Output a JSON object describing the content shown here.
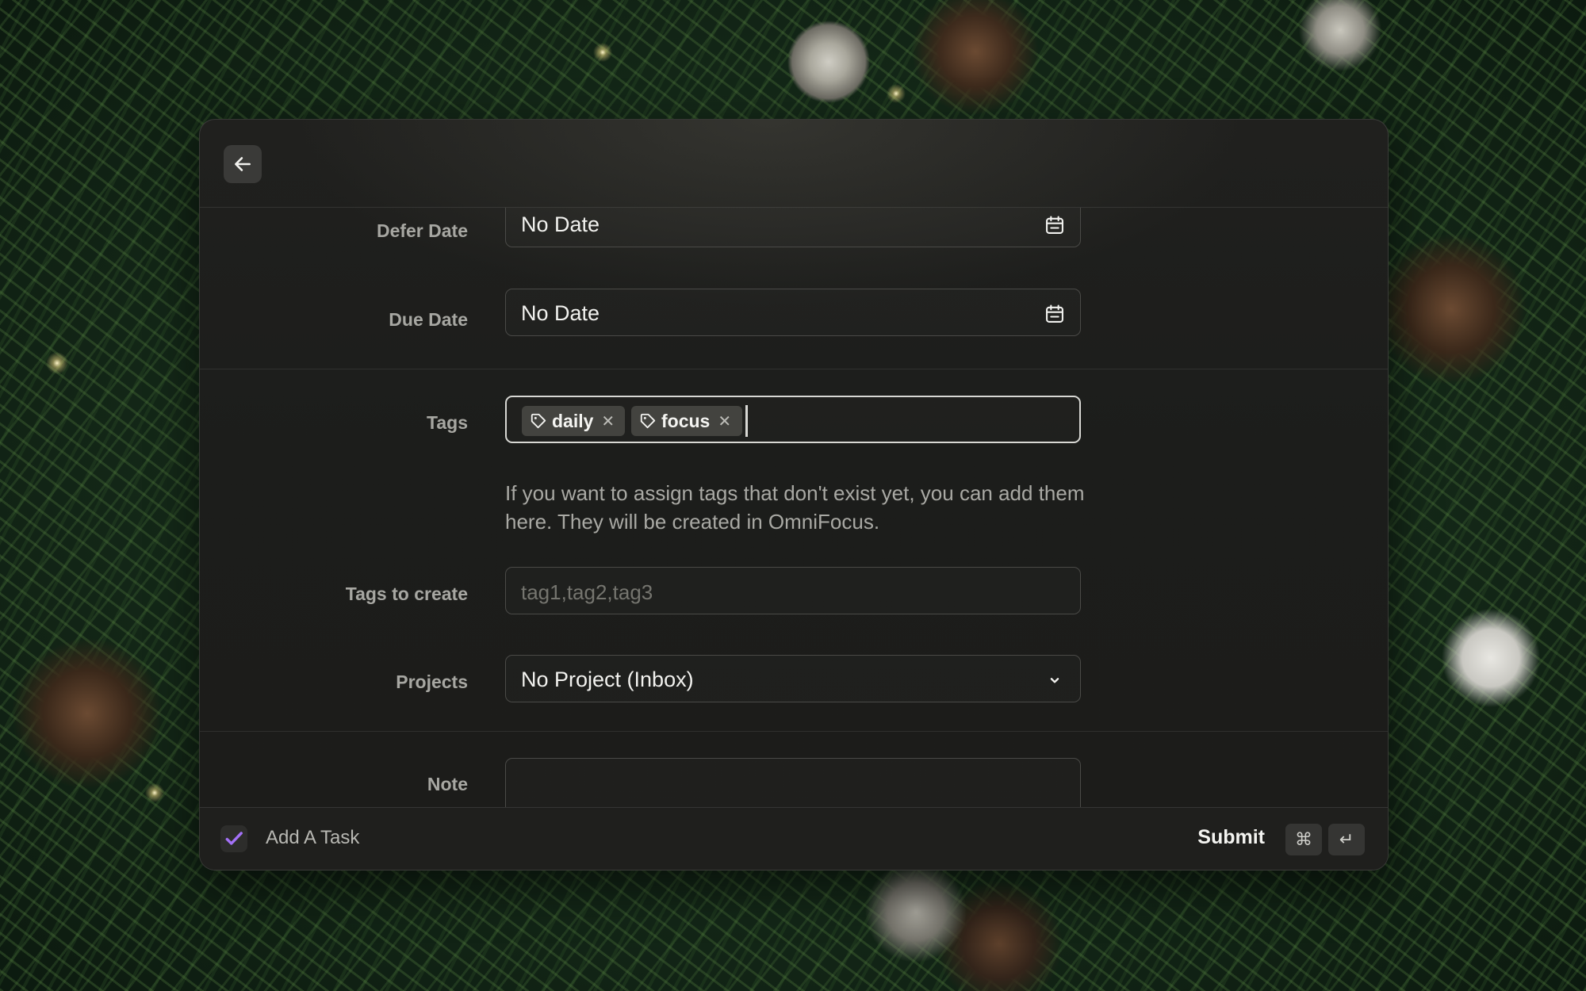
{
  "header": {
    "back_icon": "arrow-left-icon"
  },
  "form": {
    "defer_date": {
      "label": "Defer Date",
      "value": "No Date",
      "icon": "calendar-icon"
    },
    "due_date": {
      "label": "Due Date",
      "value": "No Date",
      "icon": "calendar-icon"
    },
    "tags": {
      "label": "Tags",
      "items": [
        {
          "label": "daily",
          "icon": "tag-icon"
        },
        {
          "label": "focus",
          "icon": "tag-icon"
        }
      ]
    },
    "tags_help": "If you want to assign tags that don't exist yet, you can add them here. They will be created in OmniFocus.",
    "tags_to_create": {
      "label": "Tags to create",
      "placeholder": "tag1,tag2,tag3",
      "value": ""
    },
    "projects": {
      "label": "Projects",
      "value": "No Project (Inbox)",
      "icon": "chevron-down-icon"
    },
    "note": {
      "label": "Note",
      "value": ""
    }
  },
  "footer": {
    "title": "Add A Task",
    "submit_label": "Submit",
    "shortcut_keys": [
      "⌘",
      "↵"
    ]
  },
  "colors": {
    "accent": "#8b5cf6",
    "panel_background": "#1c1c1a",
    "text_primary": "#f2f2ef",
    "text_secondary": "#a7a7a2"
  }
}
